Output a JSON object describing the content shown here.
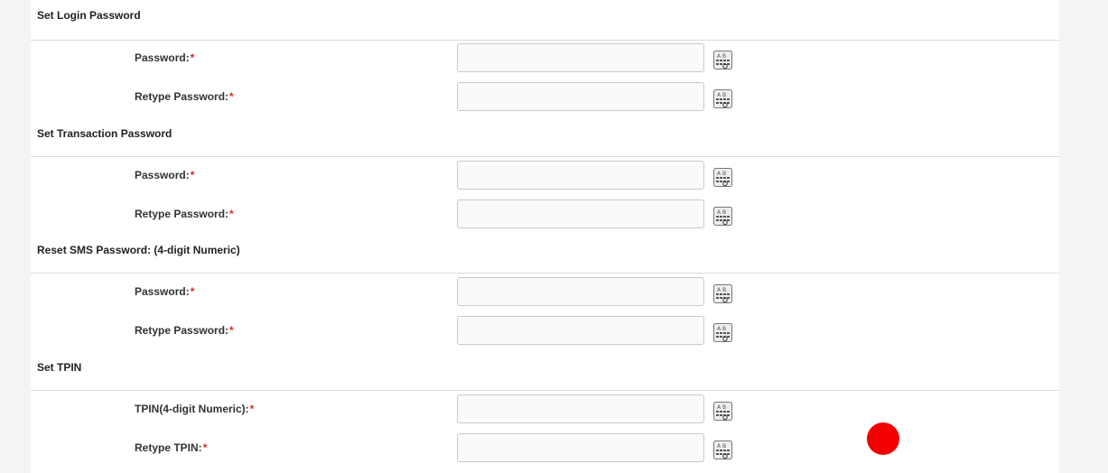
{
  "sections": [
    {
      "title": "Set Login Password",
      "rows": [
        {
          "label": "Password:",
          "required": "*",
          "value": ""
        },
        {
          "label": "Retype Password:",
          "required": "*",
          "value": ""
        }
      ]
    },
    {
      "title": "Set Transaction Password",
      "rows": [
        {
          "label": "Password:",
          "required": "*",
          "value": ""
        },
        {
          "label": "Retype Password:",
          "required": "*",
          "value": ""
        }
      ]
    },
    {
      "title": "Reset SMS Password: (4-digit Numeric)",
      "rows": [
        {
          "label": "Password:",
          "required": "*",
          "value": ""
        },
        {
          "label": "Retype Password:",
          "required": "*",
          "value": ""
        }
      ]
    },
    {
      "title": "Set TPIN",
      "rows": [
        {
          "label": "TPIN(4-digit Numeric):",
          "required": "*",
          "value": ""
        },
        {
          "label": "Retype TPIN:",
          "required": "*",
          "value": ""
        }
      ]
    }
  ],
  "icons": {
    "virtual_keyboard": "virtual-keyboard-icon",
    "record_indicator": "record-dot"
  },
  "colors": {
    "required_marker": "#d8262b",
    "record_dot": "#f20000"
  }
}
